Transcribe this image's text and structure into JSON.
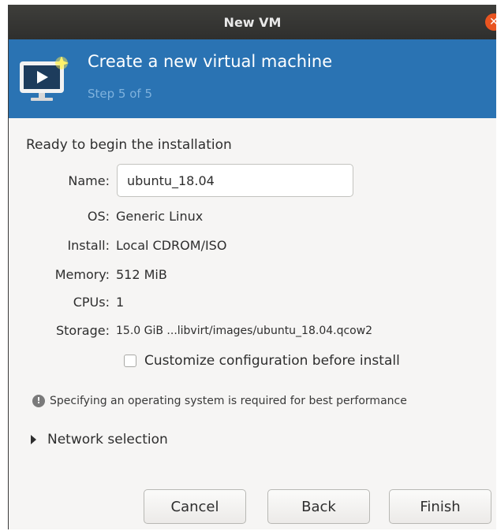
{
  "window": {
    "title": "New VM",
    "close_glyph": "✕"
  },
  "banner": {
    "title": "Create a new virtual machine",
    "step": "Step 5 of 5",
    "icon": "vm-monitor-icon"
  },
  "summary": {
    "heading": "Ready to begin the installation",
    "name_label": "Name:",
    "name_value": "ubuntu_18.04",
    "os_label": "OS:",
    "os_value": "Generic Linux",
    "install_label": "Install:",
    "install_value": "Local CDROM/ISO",
    "memory_label": "Memory:",
    "memory_value": "512 MiB",
    "cpus_label": "CPUs:",
    "cpus_value": "1",
    "storage_label": "Storage:",
    "storage_value": "15.0 GiB ...libvirt/images/ubuntu_18.04.qcow2"
  },
  "customize": {
    "label": "Customize configuration before install",
    "checked": false
  },
  "info": {
    "icon": "info-icon",
    "text": "Specifying an operating system is required for best performance"
  },
  "network": {
    "label": "Network selection",
    "expanded": false
  },
  "buttons": {
    "cancel": "Cancel",
    "back": "Back",
    "finish": "Finish"
  },
  "colors": {
    "banner": "#2a73b3",
    "titlebar": "#33332f",
    "close": "#e95420"
  }
}
